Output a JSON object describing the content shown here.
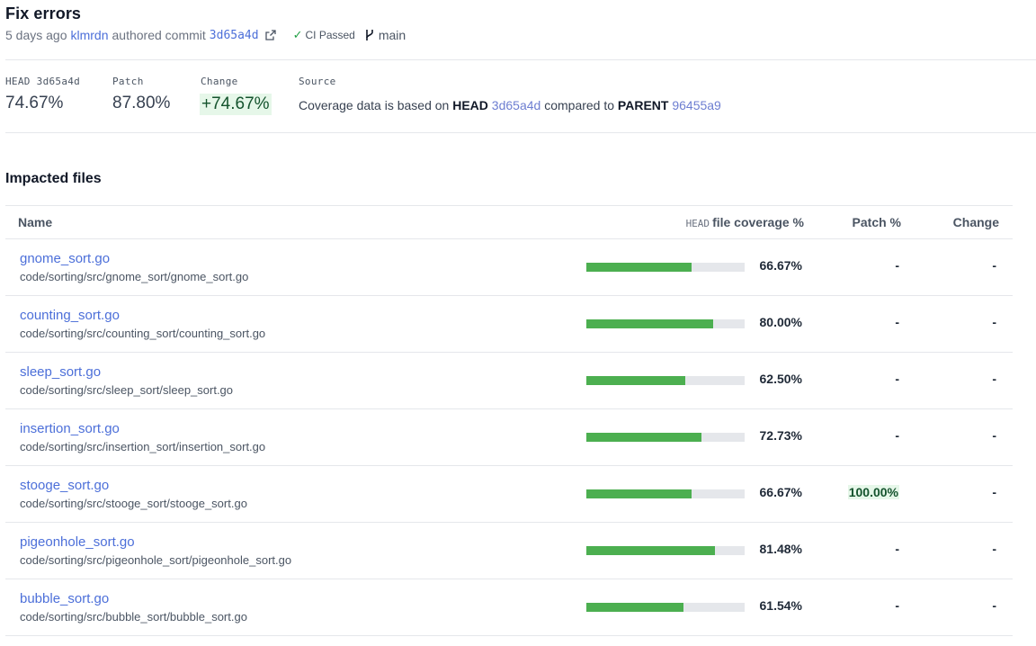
{
  "commit": {
    "title": "Fix errors",
    "time_ago": "5 days ago",
    "author": "klmrdn",
    "action": "authored commit",
    "hash": "3d65a4d",
    "ci_status": "CI Passed",
    "branch": "main"
  },
  "stats": {
    "head_label": "HEAD",
    "head_hash": "3d65a4d",
    "head_value": "74.67%",
    "patch_label": "Patch",
    "patch_value": "87.80%",
    "change_label": "Change",
    "change_value": "+74.67%",
    "source_label": "Source",
    "source_prefix": "Coverage data is based on",
    "source_head": "HEAD",
    "source_head_hash": "3d65a4d",
    "source_middle": "compared to",
    "source_parent": "PARENT",
    "source_parent_hash": "96455a9"
  },
  "impacted": {
    "title": "Impacted files",
    "columns": {
      "name": "Name",
      "coverage_head": "HEAD",
      "coverage": "file coverage %",
      "patch": "Patch %",
      "change": "Change"
    },
    "rows": [
      {
        "name": "gnome_sort.go",
        "path": "code/sorting/src/gnome_sort/gnome_sort.go",
        "coverage": "66.67%",
        "coverage_fraction": 0.6667,
        "patch": "-",
        "change": "-"
      },
      {
        "name": "counting_sort.go",
        "path": "code/sorting/src/counting_sort/counting_sort.go",
        "coverage": "80.00%",
        "coverage_fraction": 0.8,
        "patch": "-",
        "change": "-"
      },
      {
        "name": "sleep_sort.go",
        "path": "code/sorting/src/sleep_sort/sleep_sort.go",
        "coverage": "62.50%",
        "coverage_fraction": 0.625,
        "patch": "-",
        "change": "-"
      },
      {
        "name": "insertion_sort.go",
        "path": "code/sorting/src/insertion_sort/insertion_sort.go",
        "coverage": "72.73%",
        "coverage_fraction": 0.7273,
        "patch": "-",
        "change": "-"
      },
      {
        "name": "stooge_sort.go",
        "path": "code/sorting/src/stooge_sort/stooge_sort.go",
        "coverage": "66.67%",
        "coverage_fraction": 0.6667,
        "patch": "100.00%",
        "change": "-"
      },
      {
        "name": "pigeonhole_sort.go",
        "path": "code/sorting/src/pigeonhole_sort/pigeonhole_sort.go",
        "coverage": "81.48%",
        "coverage_fraction": 0.8148,
        "patch": "-",
        "change": "-"
      },
      {
        "name": "bubble_sort.go",
        "path": "code/sorting/src/bubble_sort/bubble_sort.go",
        "coverage": "61.54%",
        "coverage_fraction": 0.6154,
        "patch": "-",
        "change": "-"
      }
    ]
  },
  "colors": {
    "link": "#4c6fd9",
    "bar_fill": "#4caf50",
    "bar_track": "#e5e7eb",
    "positive_bg": "#e6f7e9",
    "ci_check": "#22a045"
  },
  "icons": {
    "external": "external-link-icon",
    "ci": "check-icon",
    "branch": "git-branch-icon"
  }
}
